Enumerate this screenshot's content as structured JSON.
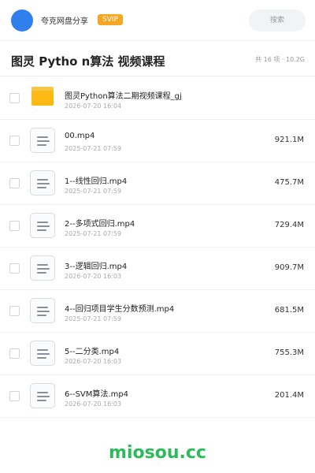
{
  "header": {
    "share_name": "夸克网盘分享",
    "badge": "SVIP",
    "search_placeholder": "搜索"
  },
  "folder": {
    "title": "图灵 Pytho n算法 视频课程",
    "summary": "共 16 项 · 10.2G"
  },
  "files": [
    {
      "name": "图灵Python算法二期视频课程_gj",
      "date": "2026-07-20 16:04",
      "size": "",
      "type": "folder"
    },
    {
      "name": "00.mp4",
      "date": "2025-07-21 07:59",
      "size": "921.1M",
      "type": "file"
    },
    {
      "name": "1--线性回归.mp4",
      "date": "2025-07-21 07:59",
      "size": "475.7M",
      "type": "file"
    },
    {
      "name": "2--多项式回归.mp4",
      "date": "2025-07-21 07:59",
      "size": "729.4M",
      "type": "file"
    },
    {
      "name": "3--逻辑回归.mp4",
      "date": "2026-07-20 16:03",
      "size": "909.7M",
      "type": "file"
    },
    {
      "name": "4--回归项目学生分数预测.mp4",
      "date": "2025-07-21 07:59",
      "size": "681.5M",
      "type": "file"
    },
    {
      "name": "5--二分类.mp4",
      "date": "2026-07-20 16:03",
      "size": "755.3M",
      "type": "file"
    },
    {
      "name": "6--SVM算法.mp4",
      "date": "2026-07-20 16:03",
      "size": "201.4M",
      "type": "file"
    }
  ],
  "watermark": "miosou.cc",
  "colors": {
    "accent": "#2f80ed",
    "svip": "#f5a623",
    "folder": "#fdb913",
    "watermark": "#2dbb5a"
  }
}
